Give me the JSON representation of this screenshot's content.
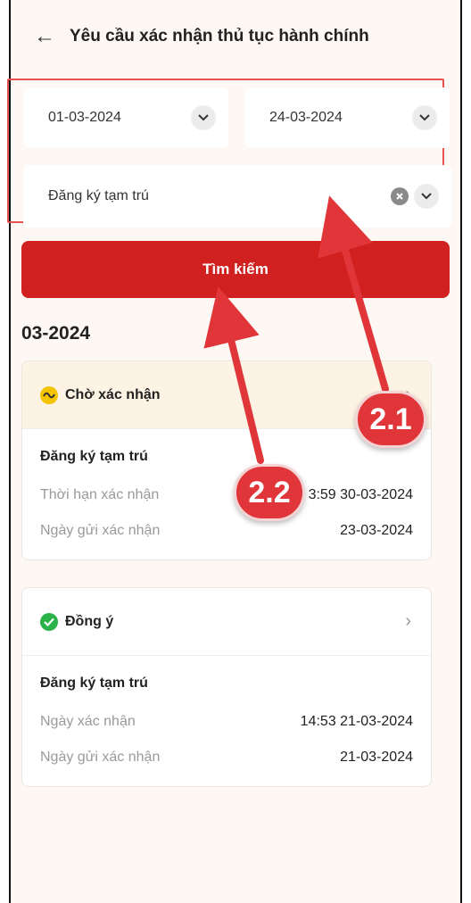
{
  "header": {
    "back_icon": "arrow-left-icon",
    "title": "Yêu cầu xác nhận thủ tục hành chính"
  },
  "filters": {
    "date_from": "01-03-2024",
    "date_to": "24-03-2024",
    "procedure_type": "Đăng ký tạm trú"
  },
  "search_button": "Tìm kiếm",
  "month_heading": "03-2024",
  "cards": [
    {
      "status": "Chờ xác nhận",
      "status_icon": "pending-icon",
      "status_color": "#f5c400",
      "procedure": "Đăng ký tạm trú",
      "rows": [
        {
          "label": "Thời hạn xác nhận",
          "value": "3:59 30-03-2024"
        },
        {
          "label": "Ngày gửi xác nhận",
          "value": "23-03-2024"
        }
      ]
    },
    {
      "status": "Đồng ý",
      "status_icon": "check-circle-icon",
      "status_color": "#2bb34a",
      "procedure": "Đăng ký tạm trú",
      "rows": [
        {
          "label": "Ngày xác nhận",
          "value": "14:53 21-03-2024"
        },
        {
          "label": "Ngày gửi xác nhận",
          "value": "21-03-2024"
        }
      ]
    }
  ],
  "annotations": {
    "callout_1": "2.1",
    "callout_2": "2.2",
    "color": "#e0363a"
  }
}
